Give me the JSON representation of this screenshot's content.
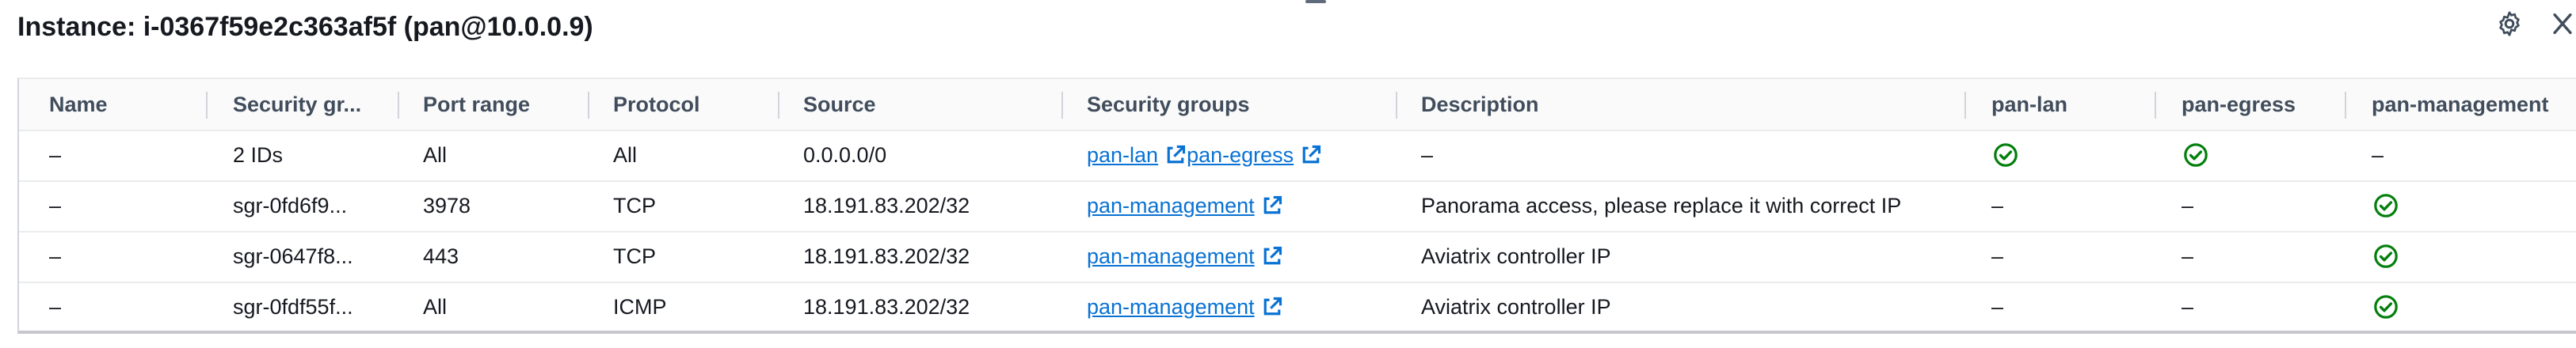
{
  "panel": {
    "title": "Instance: i-0367f59e2c363af5f (pan@10.0.0.9)"
  },
  "icons": {
    "settings": "gear-icon",
    "close": "close-icon",
    "external": "external-link-icon",
    "check": "check-circle-icon"
  },
  "colors": {
    "link": "#0972d3",
    "success": "#037f0c",
    "header_text": "#414d5c"
  },
  "table": {
    "columns": [
      "Name",
      "Security gr...",
      "Port range",
      "Protocol",
      "Source",
      "Security groups",
      "Description",
      "pan-lan",
      "pan-egress",
      "pan-management"
    ],
    "rows": [
      {
        "name": "–",
        "sg_rule": "2 IDs",
        "port": "All",
        "protocol": "All",
        "source": "0.0.0.0/0",
        "groups": [
          "pan-lan",
          "pan-egress"
        ],
        "description": "–",
        "pan_lan": "check",
        "pan_egress": "check",
        "pan_management": "–"
      },
      {
        "name": "–",
        "sg_rule": "sgr-0fd6f9...",
        "port": "3978",
        "protocol": "TCP",
        "source": "18.191.83.202/32",
        "groups": [
          "pan-management"
        ],
        "description": "Panorama access, please replace it with correct IP",
        "pan_lan": "–",
        "pan_egress": "–",
        "pan_management": "check"
      },
      {
        "name": "–",
        "sg_rule": "sgr-0647f8...",
        "port": "443",
        "protocol": "TCP",
        "source": "18.191.83.202/32",
        "groups": [
          "pan-management"
        ],
        "description": "Aviatrix controller IP",
        "pan_lan": "–",
        "pan_egress": "–",
        "pan_management": "check"
      },
      {
        "name": "–",
        "sg_rule": "sgr-0fdf55f...",
        "port": "All",
        "protocol": "ICMP",
        "source": "18.191.83.202/32",
        "groups": [
          "pan-management"
        ],
        "description": "Aviatrix controller IP",
        "pan_lan": "–",
        "pan_egress": "–",
        "pan_management": "check"
      }
    ]
  }
}
